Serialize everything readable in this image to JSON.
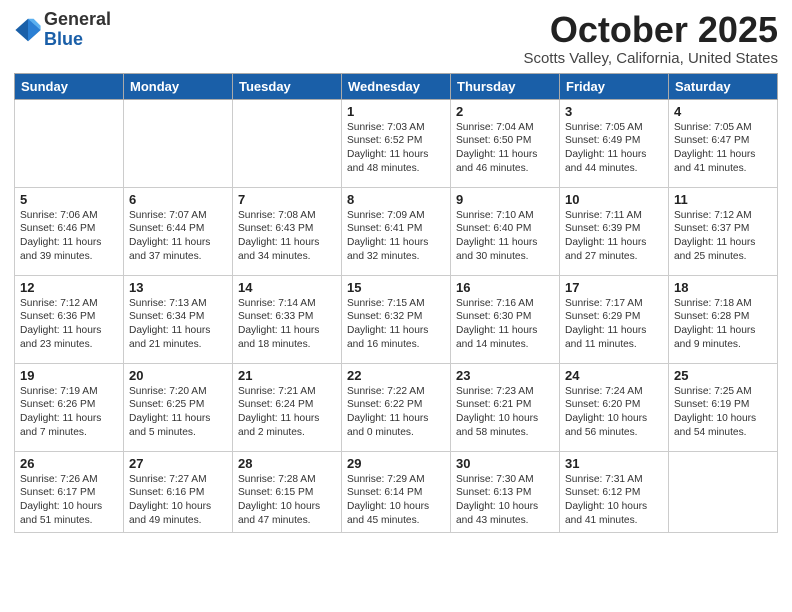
{
  "logo": {
    "general": "General",
    "blue": "Blue"
  },
  "header": {
    "month": "October 2025",
    "location": "Scotts Valley, California, United States"
  },
  "days_of_week": [
    "Sunday",
    "Monday",
    "Tuesday",
    "Wednesday",
    "Thursday",
    "Friday",
    "Saturday"
  ],
  "weeks": [
    [
      {
        "day": "",
        "info": ""
      },
      {
        "day": "",
        "info": ""
      },
      {
        "day": "",
        "info": ""
      },
      {
        "day": "1",
        "info": "Sunrise: 7:03 AM\nSunset: 6:52 PM\nDaylight: 11 hours and 48 minutes."
      },
      {
        "day": "2",
        "info": "Sunrise: 7:04 AM\nSunset: 6:50 PM\nDaylight: 11 hours and 46 minutes."
      },
      {
        "day": "3",
        "info": "Sunrise: 7:05 AM\nSunset: 6:49 PM\nDaylight: 11 hours and 44 minutes."
      },
      {
        "day": "4",
        "info": "Sunrise: 7:05 AM\nSunset: 6:47 PM\nDaylight: 11 hours and 41 minutes."
      }
    ],
    [
      {
        "day": "5",
        "info": "Sunrise: 7:06 AM\nSunset: 6:46 PM\nDaylight: 11 hours and 39 minutes."
      },
      {
        "day": "6",
        "info": "Sunrise: 7:07 AM\nSunset: 6:44 PM\nDaylight: 11 hours and 37 minutes."
      },
      {
        "day": "7",
        "info": "Sunrise: 7:08 AM\nSunset: 6:43 PM\nDaylight: 11 hours and 34 minutes."
      },
      {
        "day": "8",
        "info": "Sunrise: 7:09 AM\nSunset: 6:41 PM\nDaylight: 11 hours and 32 minutes."
      },
      {
        "day": "9",
        "info": "Sunrise: 7:10 AM\nSunset: 6:40 PM\nDaylight: 11 hours and 30 minutes."
      },
      {
        "day": "10",
        "info": "Sunrise: 7:11 AM\nSunset: 6:39 PM\nDaylight: 11 hours and 27 minutes."
      },
      {
        "day": "11",
        "info": "Sunrise: 7:12 AM\nSunset: 6:37 PM\nDaylight: 11 hours and 25 minutes."
      }
    ],
    [
      {
        "day": "12",
        "info": "Sunrise: 7:12 AM\nSunset: 6:36 PM\nDaylight: 11 hours and 23 minutes."
      },
      {
        "day": "13",
        "info": "Sunrise: 7:13 AM\nSunset: 6:34 PM\nDaylight: 11 hours and 21 minutes."
      },
      {
        "day": "14",
        "info": "Sunrise: 7:14 AM\nSunset: 6:33 PM\nDaylight: 11 hours and 18 minutes."
      },
      {
        "day": "15",
        "info": "Sunrise: 7:15 AM\nSunset: 6:32 PM\nDaylight: 11 hours and 16 minutes."
      },
      {
        "day": "16",
        "info": "Sunrise: 7:16 AM\nSunset: 6:30 PM\nDaylight: 11 hours and 14 minutes."
      },
      {
        "day": "17",
        "info": "Sunrise: 7:17 AM\nSunset: 6:29 PM\nDaylight: 11 hours and 11 minutes."
      },
      {
        "day": "18",
        "info": "Sunrise: 7:18 AM\nSunset: 6:28 PM\nDaylight: 11 hours and 9 minutes."
      }
    ],
    [
      {
        "day": "19",
        "info": "Sunrise: 7:19 AM\nSunset: 6:26 PM\nDaylight: 11 hours and 7 minutes."
      },
      {
        "day": "20",
        "info": "Sunrise: 7:20 AM\nSunset: 6:25 PM\nDaylight: 11 hours and 5 minutes."
      },
      {
        "day": "21",
        "info": "Sunrise: 7:21 AM\nSunset: 6:24 PM\nDaylight: 11 hours and 2 minutes."
      },
      {
        "day": "22",
        "info": "Sunrise: 7:22 AM\nSunset: 6:22 PM\nDaylight: 11 hours and 0 minutes."
      },
      {
        "day": "23",
        "info": "Sunrise: 7:23 AM\nSunset: 6:21 PM\nDaylight: 10 hours and 58 minutes."
      },
      {
        "day": "24",
        "info": "Sunrise: 7:24 AM\nSunset: 6:20 PM\nDaylight: 10 hours and 56 minutes."
      },
      {
        "day": "25",
        "info": "Sunrise: 7:25 AM\nSunset: 6:19 PM\nDaylight: 10 hours and 54 minutes."
      }
    ],
    [
      {
        "day": "26",
        "info": "Sunrise: 7:26 AM\nSunset: 6:17 PM\nDaylight: 10 hours and 51 minutes."
      },
      {
        "day": "27",
        "info": "Sunrise: 7:27 AM\nSunset: 6:16 PM\nDaylight: 10 hours and 49 minutes."
      },
      {
        "day": "28",
        "info": "Sunrise: 7:28 AM\nSunset: 6:15 PM\nDaylight: 10 hours and 47 minutes."
      },
      {
        "day": "29",
        "info": "Sunrise: 7:29 AM\nSunset: 6:14 PM\nDaylight: 10 hours and 45 minutes."
      },
      {
        "day": "30",
        "info": "Sunrise: 7:30 AM\nSunset: 6:13 PM\nDaylight: 10 hours and 43 minutes."
      },
      {
        "day": "31",
        "info": "Sunrise: 7:31 AM\nSunset: 6:12 PM\nDaylight: 10 hours and 41 minutes."
      },
      {
        "day": "",
        "info": ""
      }
    ]
  ]
}
